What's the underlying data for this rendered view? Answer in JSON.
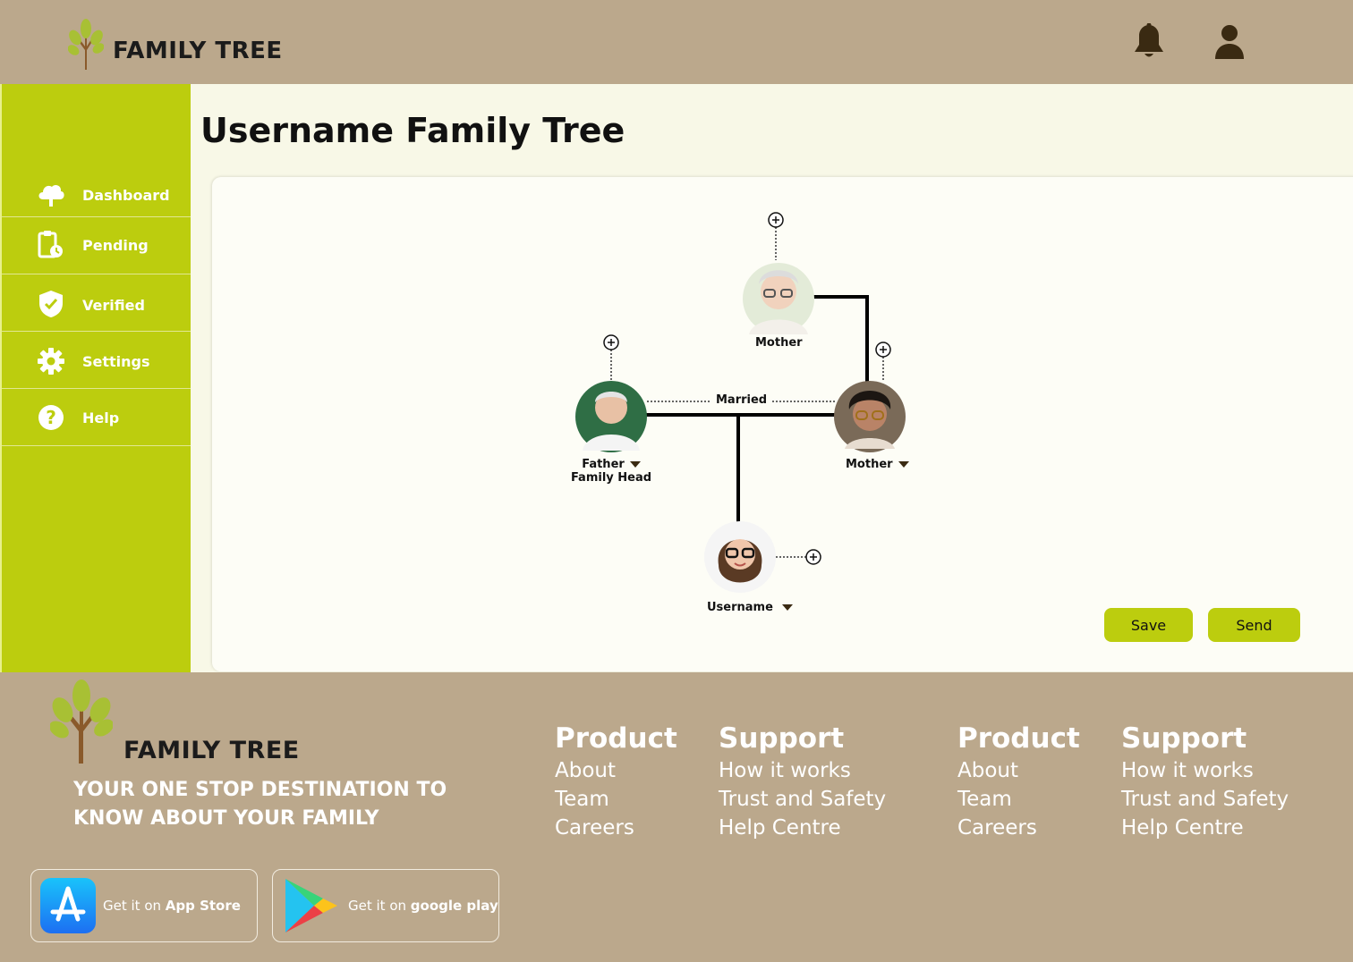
{
  "app": {
    "logo_text": "FAMILY TREE"
  },
  "header": {
    "notification_icon": "bell-icon",
    "profile_icon": "user-icon"
  },
  "sidebar": {
    "items": [
      {
        "label": "Dashboard",
        "icon": "cloud-tree-icon"
      },
      {
        "label": "Pending",
        "icon": "clipboard-clock-icon"
      },
      {
        "label": "Verified",
        "icon": "shield-check-icon"
      },
      {
        "label": "Settings",
        "icon": "gear-icon"
      },
      {
        "label": "Help",
        "icon": "question-icon"
      }
    ]
  },
  "main": {
    "title": "Username Family Tree",
    "tree": {
      "grandmother_label": "Mother",
      "father_label": "Father",
      "father_sublabel": "Family Head",
      "mother_label": "Mother",
      "child_label": "Username",
      "relation_label": "Married"
    },
    "save_label": "Save",
    "send_label": "Send"
  },
  "footer": {
    "logo_text": "FAMILY TREE",
    "tagline": "YOUR ONE STOP DESTINATION TO KNOW ABOUT YOUR FAMILY",
    "app_store": {
      "prefix": "Get it on ",
      "name": "App Store"
    },
    "google_play": {
      "prefix": "Get it on ",
      "name": "google play"
    },
    "columns": [
      {
        "heading": "Product",
        "links": [
          "About",
          "Team",
          "Careers"
        ]
      },
      {
        "heading": "Support",
        "links": [
          "How it works",
          "Trust and Safety",
          "Help Centre"
        ]
      },
      {
        "heading": "Product",
        "links": [
          "About",
          "Team",
          "Careers"
        ]
      },
      {
        "heading": "Support",
        "links": [
          "How it works",
          "Trust and Safety",
          "Help Centre"
        ]
      }
    ]
  },
  "colors": {
    "header_bg": "#bba88c",
    "sidebar_bg": "#bccd0e",
    "main_bg": "#f8f8e7",
    "accent": "#bccd0e",
    "icon_dark": "#3a2a12"
  }
}
